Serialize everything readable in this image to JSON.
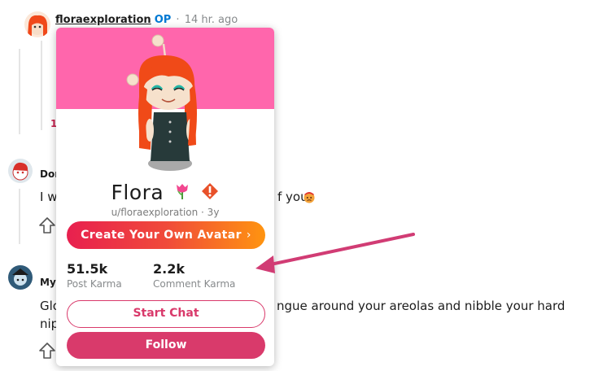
{
  "op_comment": {
    "username": "floraexploration",
    "op_badge": "OP",
    "separator": "·",
    "time": "14 hr. ago"
  },
  "background_comments": [
    {
      "author_fragment": "Dor",
      "text_left": "I w",
      "text_right": "f you",
      "emoji": "angry-face"
    },
    {
      "author_fragment": "Myi",
      "text_left": "Glo",
      "text_right": "ngue around your areolas and nibble your hard",
      "text_line2": "nip"
    }
  ],
  "background_vote_fragment": "1",
  "profile_card": {
    "display_name": "Flora",
    "handle_line": "u/floraexploration · 3y",
    "create_avatar_label": "Create Your Own Avatar",
    "create_avatar_chevron": "›",
    "stats": [
      {
        "value": "51.5k",
        "label": "Post Karma"
      },
      {
        "value": "2.2k",
        "label": "Comment Karma"
      }
    ],
    "start_chat_label": "Start Chat",
    "follow_label": "Follow"
  },
  "colors": {
    "banner": "#ff66ac",
    "accent": "#d93a6b",
    "op_blue": "#0079d3",
    "annotation_arrow": "#d13c74"
  },
  "icons": [
    "snoo-avatar-icon",
    "tulip-icon",
    "moderator-diamond-icon",
    "upvote-icon",
    "annotation-arrow"
  ]
}
